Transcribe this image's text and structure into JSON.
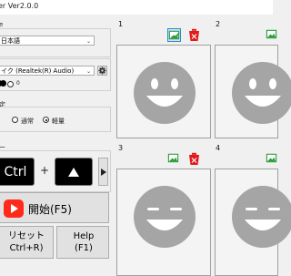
{
  "window": {
    "title": "er Ver2.0.0"
  },
  "language": {
    "label": "e",
    "value": "日本語"
  },
  "audio": {
    "device": "イク (Realtek(R) Audio)",
    "level": "0"
  },
  "mode": {
    "label": "定",
    "options": [
      "通常",
      "軽量"
    ],
    "selected": "軽量"
  },
  "hotkey": {
    "label": "ー",
    "key1": "Ctrl",
    "plus": "+"
  },
  "start_button": {
    "label": "開始(F5)"
  },
  "reset_button": {
    "line1": "リセット",
    "line2": "Ctrl+R)"
  },
  "help_button": {
    "line1": "Help",
    "line2": "(F1)"
  },
  "panels": [
    {
      "number": "1",
      "face": "happy"
    },
    {
      "number": "2",
      "face": "happy"
    },
    {
      "number": "3",
      "face": "laughing"
    },
    {
      "number": "4",
      "face": "laughing"
    }
  ],
  "colors": {
    "face": "#a5a5a5",
    "accent_red": "#e0191b",
    "start_red": "#ff2a1a",
    "check_green": "#2e9e3c",
    "selected_blue": "#2f86d4"
  }
}
